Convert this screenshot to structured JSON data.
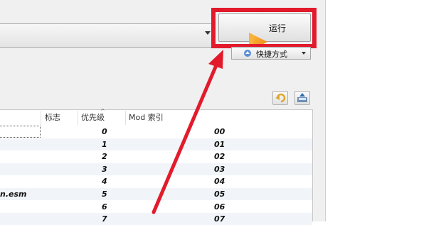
{
  "toolbar": {
    "run_label": "运行",
    "shortcut_label": "快捷方式"
  },
  "table": {
    "columns": [
      "标志",
      "优先级",
      "Mod 索引"
    ],
    "rows": [
      {
        "name": "",
        "priority": "0",
        "index": "00"
      },
      {
        "name": "",
        "priority": "1",
        "index": "01"
      },
      {
        "name": "",
        "priority": "2",
        "index": "02"
      },
      {
        "name": "",
        "priority": "3",
        "index": "03"
      },
      {
        "name": "",
        "priority": "4",
        "index": "04"
      },
      {
        "name": "n.esm",
        "priority": "5",
        "index": "05"
      },
      {
        "name": "",
        "priority": "6",
        "index": "06"
      },
      {
        "name": "",
        "priority": "7",
        "index": "07"
      }
    ]
  },
  "colors": {
    "highlight": "#e21b2c",
    "row_alt": "#f1f4f8",
    "play_icon": "#f39a1c"
  },
  "icons": [
    "play-icon",
    "shortcut-icon",
    "undo-icon",
    "export-icon",
    "sort-up-icon"
  ]
}
